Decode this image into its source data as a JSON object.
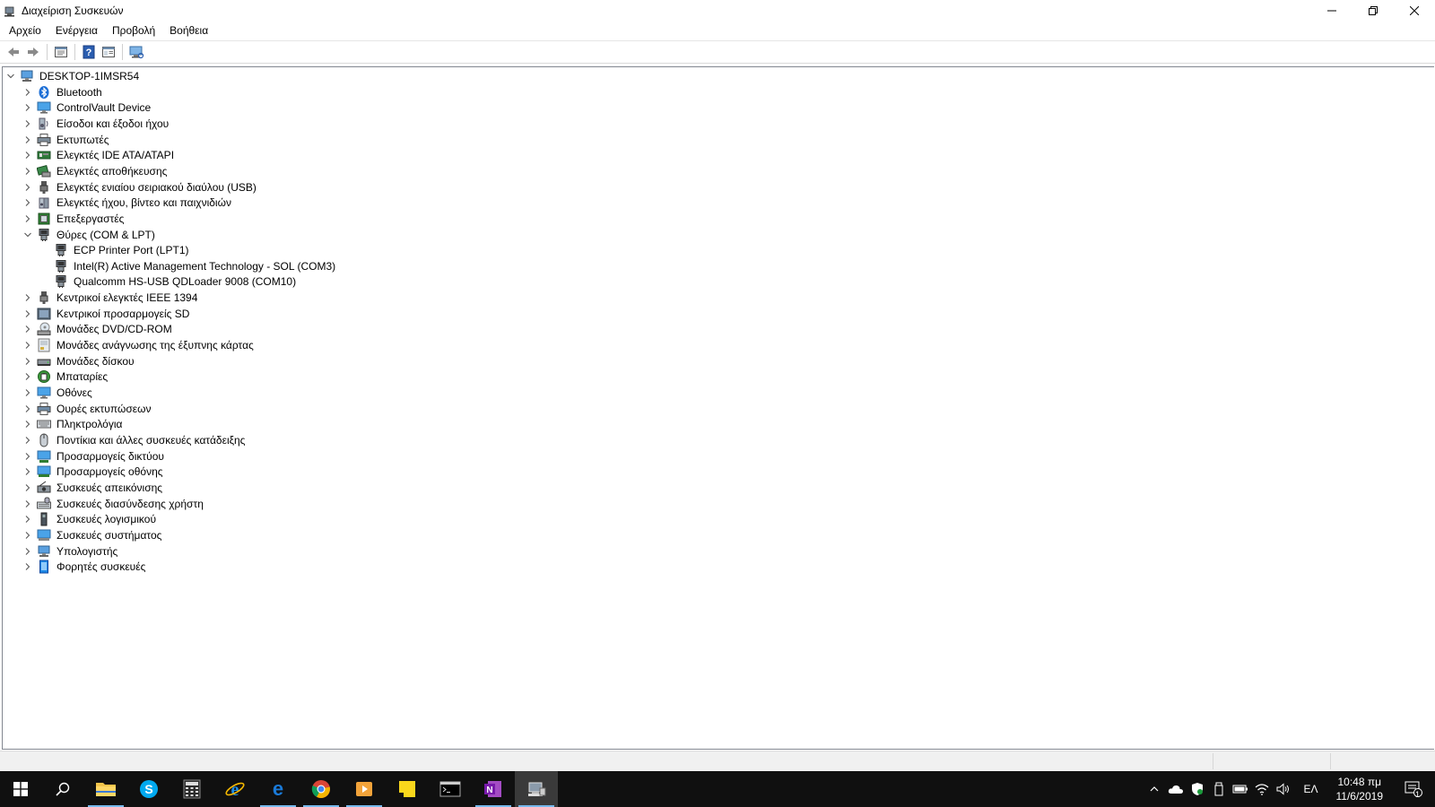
{
  "window": {
    "title": "Διαχείριση Συσκευών",
    "controls": {
      "minimize": "—",
      "restore": "❐",
      "close": "✕"
    }
  },
  "menu": [
    "Αρχείο",
    "Ενέργεια",
    "Προβολή",
    "Βοήθεια"
  ],
  "toolbar": {
    "icons": [
      "back-arrow-icon",
      "forward-arrow-icon",
      "properties-icon",
      "help-icon",
      "details-pane-icon",
      "scan-hardware-icon"
    ]
  },
  "tree": {
    "root": {
      "label": "DESKTOP-1IMSR54",
      "expanded": true,
      "icon": "computer-icon"
    },
    "categories": [
      {
        "label": "Bluetooth",
        "icon": "bluetooth-icon",
        "expanded": false
      },
      {
        "label": "ControlVault Device",
        "icon": "monitor-icon",
        "expanded": false
      },
      {
        "label": "Είσοδοι και έξοδοι ήχου",
        "icon": "speaker-icon",
        "expanded": false
      },
      {
        "label": "Εκτυπωτές",
        "icon": "printer-icon",
        "expanded": false
      },
      {
        "label": "Ελεγκτές IDE ATA/ATAPI",
        "icon": "ide-controller-icon",
        "expanded": false
      },
      {
        "label": "Ελεγκτές αποθήκευσης",
        "icon": "storage-controller-icon",
        "expanded": false
      },
      {
        "label": "Ελεγκτές ενιαίου σειριακού διαύλου (USB)",
        "icon": "usb-icon",
        "expanded": false
      },
      {
        "label": "Ελεγκτές ήχου, βίντεο και παιχνιδιών",
        "icon": "sound-icon",
        "expanded": false
      },
      {
        "label": "Επεξεργαστές",
        "icon": "processor-icon",
        "expanded": false
      },
      {
        "label": "Θύρες (COM & LPT)",
        "icon": "port-icon",
        "expanded": true,
        "children": [
          {
            "label": "ECP Printer Port (LPT1)",
            "icon": "port-icon"
          },
          {
            "label": "Intel(R) Active Management Technology - SOL (COM3)",
            "icon": "port-icon"
          },
          {
            "label": "Qualcomm HS-USB QDLoader 9008 (COM10)",
            "icon": "port-icon"
          }
        ]
      },
      {
        "label": "Κεντρικοί ελεγκτές IEEE 1394",
        "icon": "ieee1394-icon",
        "expanded": false
      },
      {
        "label": "Κεντρικοί προσαρμογείς SD",
        "icon": "sd-host-icon",
        "expanded": false
      },
      {
        "label": "Μονάδες DVD/CD-ROM",
        "icon": "dvd-drive-icon",
        "expanded": false
      },
      {
        "label": "Μονάδες ανάγνωσης της έξυπνης κάρτας",
        "icon": "smartcard-reader-icon",
        "expanded": false
      },
      {
        "label": "Μονάδες δίσκου",
        "icon": "disk-drive-icon",
        "expanded": false
      },
      {
        "label": "Μπαταρίες",
        "icon": "battery-icon",
        "expanded": false
      },
      {
        "label": "Οθόνες",
        "icon": "monitor-icon",
        "expanded": false
      },
      {
        "label": "Ουρές εκτυπώσεων",
        "icon": "print-queue-icon",
        "expanded": false
      },
      {
        "label": "Πληκτρολόγια",
        "icon": "keyboard-icon",
        "expanded": false
      },
      {
        "label": "Ποντίκια και άλλες συσκευές κατάδειξης",
        "icon": "mouse-icon",
        "expanded": false
      },
      {
        "label": "Προσαρμογείς δικτύου",
        "icon": "network-adapter-icon",
        "expanded": false
      },
      {
        "label": "Προσαρμογείς οθόνης",
        "icon": "display-adapter-icon",
        "expanded": false
      },
      {
        "label": "Συσκευές απεικόνισης",
        "icon": "imaging-device-icon",
        "expanded": false
      },
      {
        "label": "Συσκευές διασύνδεσης χρήστη",
        "icon": "hid-icon",
        "expanded": false
      },
      {
        "label": "Συσκευές λογισμικού",
        "icon": "software-device-icon",
        "expanded": false
      },
      {
        "label": "Συσκευές συστήματος",
        "icon": "system-device-icon",
        "expanded": false
      },
      {
        "label": "Υπολογιστής",
        "icon": "computer-icon",
        "expanded": false
      },
      {
        "label": "Φορητές συσκευές",
        "icon": "portable-device-icon",
        "expanded": false
      }
    ]
  },
  "taskbar": {
    "apps": [
      {
        "name": "start-button",
        "icon": "windows-logo-icon"
      },
      {
        "name": "search-button",
        "icon": "search-icon"
      },
      {
        "name": "file-explorer",
        "icon": "folder-icon",
        "running": true
      },
      {
        "name": "skype",
        "icon": "skype-icon"
      },
      {
        "name": "calculator",
        "icon": "calculator-icon"
      },
      {
        "name": "internet-explorer",
        "icon": "ie-icon"
      },
      {
        "name": "edge",
        "icon": "edge-icon",
        "running": true
      },
      {
        "name": "chrome",
        "icon": "chrome-icon",
        "running": true
      },
      {
        "name": "media-player",
        "icon": "media-player-icon",
        "running": true
      },
      {
        "name": "sticky-notes",
        "icon": "sticky-notes-icon"
      },
      {
        "name": "command-prompt",
        "icon": "cmd-icon"
      },
      {
        "name": "onenote",
        "icon": "onenote-icon",
        "running": true
      },
      {
        "name": "device-manager",
        "icon": "device-manager-icon",
        "running": true,
        "active": true
      }
    ],
    "tray": {
      "icons": [
        "chevron-up-icon",
        "onedrive-icon",
        "defender-icon",
        "usb-eject-icon",
        "battery-icon",
        "wifi-icon",
        "volume-icon"
      ],
      "language": "ΕΛ",
      "time": "10:48 πμ",
      "date": "11/6/2019",
      "notification_count": "1"
    }
  },
  "colors": {
    "taskbar_bg": "#101010",
    "running_indicator": "#76b9ed",
    "selection": "#cce8ff"
  }
}
